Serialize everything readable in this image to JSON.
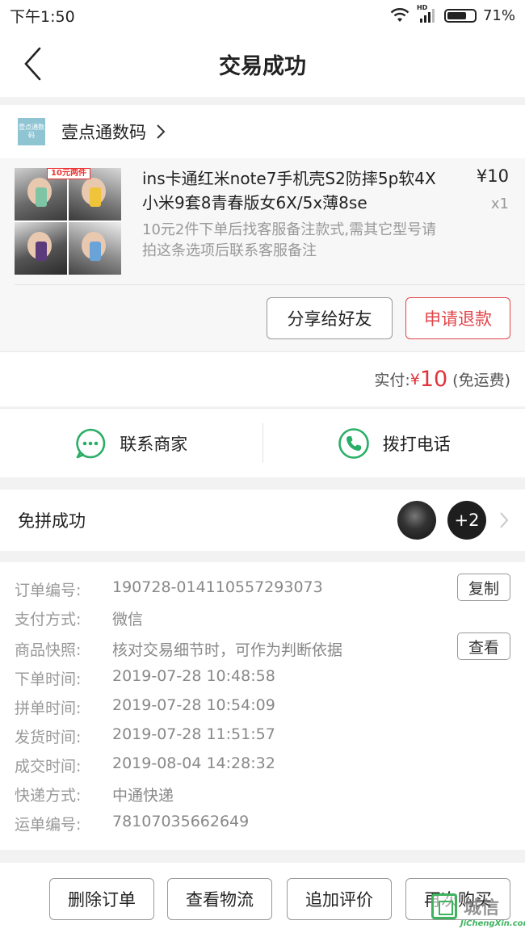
{
  "status_bar": {
    "time": "下午1:50",
    "network": "HD",
    "battery": "71%",
    "battery_level": 0.71
  },
  "header": {
    "title": "交易成功"
  },
  "shop": {
    "logo_text": "壹点通数码",
    "name": "壹点通数码"
  },
  "product": {
    "image_tag": "10元两件",
    "title": "ins卡通红米note7手机壳S2防摔5p软4X小米9套8青春版女6X/5x薄8se",
    "description": "10元2件下单后找客服备注款式,需其它型号请拍这条选项后联系客服备注",
    "price": "¥10",
    "quantity": "x1",
    "share_label": "分享给好友",
    "refund_label": "申请退款"
  },
  "payment": {
    "label": "实付:",
    "currency": "¥",
    "amount": "10",
    "note": "(免运费)"
  },
  "contact": {
    "merchant_label": "联系商家",
    "phone_label": "拨打电话"
  },
  "group": {
    "label": "免拼成功",
    "more_count": "+2"
  },
  "order_details": {
    "rows": [
      {
        "label": "订单编号:",
        "value": "190728-014110557293073"
      },
      {
        "label": "支付方式:",
        "value": "微信"
      },
      {
        "label": "商品快照:",
        "value": "核对交易细节时，可作为判断依据"
      },
      {
        "label": "下单时间:",
        "value": "2019-07-28 10:48:58"
      },
      {
        "label": "拼单时间:",
        "value": "2019-07-28 10:54:09"
      },
      {
        "label": "发货时间:",
        "value": "2019-07-28 11:51:57"
      },
      {
        "label": "成交时间:",
        "value": "2019-08-04 14:28:32"
      },
      {
        "label": "快递方式:",
        "value": "中通快递"
      },
      {
        "label": "运单编号:",
        "value": "78107035662649"
      }
    ],
    "copy_label": "复制",
    "view_label": "查看"
  },
  "bottom_actions": {
    "delete": "删除订单",
    "logistics": "查看物流",
    "review": "追加评价",
    "rebuy": "再次购买"
  },
  "watermark": {
    "text": "城信",
    "subtext": "JiChengXin.com"
  },
  "colors": {
    "accent_red": "#e0333a",
    "wechat_green": "#2aae67"
  }
}
